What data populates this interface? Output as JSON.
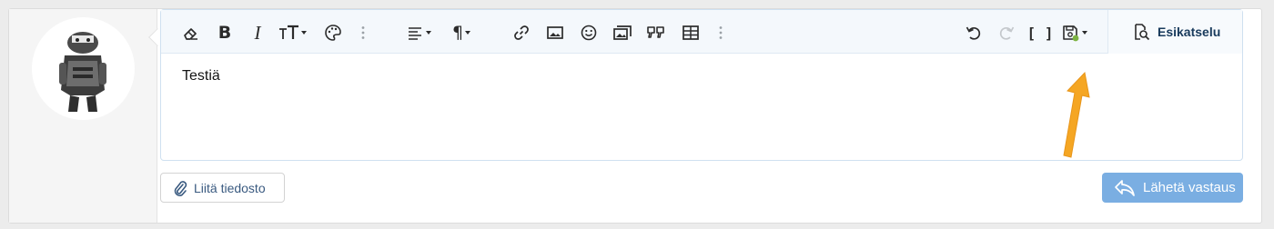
{
  "editor": {
    "content_text": "Testiä",
    "toolbar": {
      "buttons": [
        {
          "id": "clear-formatting",
          "icon": "eraser-icon",
          "label": "",
          "disabled": false
        },
        {
          "id": "bold",
          "icon": "bold-icon",
          "label": "B",
          "disabled": false
        },
        {
          "id": "italic",
          "icon": "italic-icon",
          "label": "I",
          "disabled": false
        },
        {
          "id": "font-size",
          "icon": "text-size-icon",
          "label": "",
          "disabled": false
        },
        {
          "id": "text-color",
          "icon": "palette-icon",
          "label": "",
          "disabled": false
        },
        {
          "id": "more-text",
          "icon": "kebab-icon",
          "label": "",
          "disabled": false
        },
        {
          "id": "align",
          "icon": "align-left-icon",
          "label": "",
          "disabled": false
        },
        {
          "id": "paragraph",
          "icon": "pilcrow-icon",
          "label": "¶",
          "disabled": false
        },
        {
          "id": "link",
          "icon": "link-icon",
          "label": "",
          "disabled": false
        },
        {
          "id": "image",
          "icon": "image-icon",
          "label": "",
          "disabled": false
        },
        {
          "id": "emoji",
          "icon": "smiley-icon",
          "label": "",
          "disabled": false
        },
        {
          "id": "media",
          "icon": "media-icon",
          "label": "",
          "disabled": false
        },
        {
          "id": "quote",
          "icon": "quote-icon",
          "label": "",
          "disabled": false
        },
        {
          "id": "table",
          "icon": "table-icon",
          "label": "",
          "disabled": false
        },
        {
          "id": "more-insert",
          "icon": "kebab-icon",
          "label": "",
          "disabled": false
        },
        {
          "id": "undo",
          "icon": "undo-icon",
          "label": "",
          "disabled": false
        },
        {
          "id": "redo",
          "icon": "redo-icon",
          "label": "",
          "disabled": true
        },
        {
          "id": "bbcode",
          "icon": "brackets-icon",
          "label": "[ ]",
          "disabled": false
        },
        {
          "id": "drafts",
          "icon": "save-draft-icon",
          "label": "",
          "disabled": false
        }
      ],
      "preview_label": "Esikatselu"
    }
  },
  "actions": {
    "attach_label": "Liitä tiedosto",
    "send_label": "Lähetä vastaus"
  },
  "colors": {
    "accent": "#7aaee2",
    "toolbar_bg": "#f4f8fc",
    "draft_saved_dot": "#7cb342",
    "annotation_arrow": "#f5a623"
  }
}
